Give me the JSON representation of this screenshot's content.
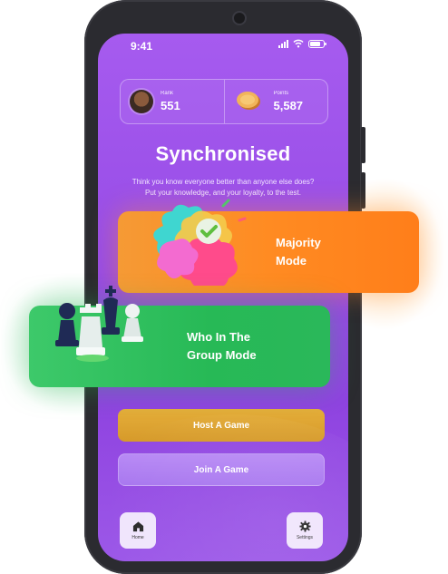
{
  "status_bar": {
    "time": "9:41"
  },
  "stats": {
    "rank": {
      "label": "Rank",
      "value": "551"
    },
    "points": {
      "label": "Points",
      "value": "5,587"
    }
  },
  "header": {
    "title": "Synchronised",
    "subtitle": "Think you know everyone better than anyone else does? Put your knowledge, and your loyalty, to the test."
  },
  "modes": {
    "majority": {
      "line1": "Majority",
      "line2": "Mode"
    },
    "who": {
      "line1": "Who In The",
      "line2": "Group Mode"
    }
  },
  "actions": {
    "host_label": "Host A Game",
    "join_label": "Join A Game"
  },
  "nav": {
    "home_label": "Home",
    "settings_label": "Settings"
  },
  "colors": {
    "screen_purple": "#9a4fe8",
    "majority_orange": "#ff8b22",
    "who_green": "#27b956",
    "host_gold": "#d69a2a",
    "join_lavender": "#a877ef"
  }
}
